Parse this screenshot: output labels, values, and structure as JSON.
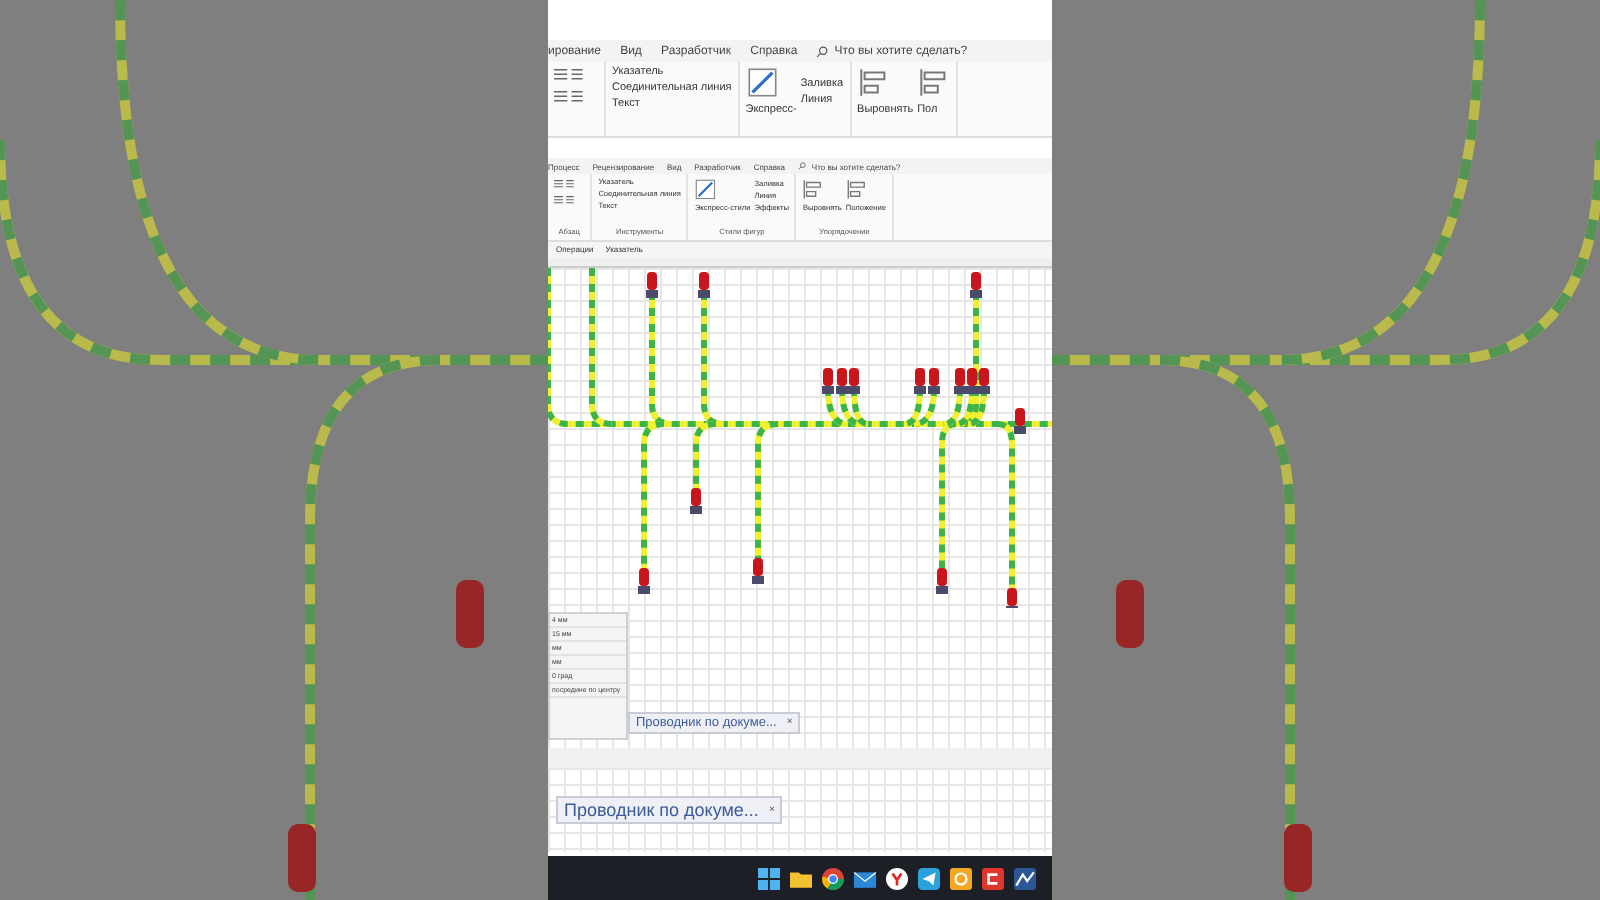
{
  "ribbon_top": {
    "tabs": [
      "ирование",
      "Вид",
      "Разработчик",
      "Справка"
    ],
    "search": "Что вы хотите сделать?",
    "tools": [
      "Указатель",
      "Соединительная линия",
      "Текст"
    ],
    "styles": "Экспресс-",
    "format": [
      "Заливка",
      "Линия"
    ],
    "arrange": [
      "Выровнять",
      "Пол"
    ]
  },
  "ribbon": {
    "tabs": [
      "Процесс",
      "Рецензирование",
      "Вид",
      "Разработчик",
      "Справка"
    ],
    "search": "Что вы хотите сделать?",
    "tools": [
      "Указатель",
      "Соединительная линия",
      "Текст"
    ],
    "styles": "Экспресс-стили",
    "format": [
      "Заливка",
      "Линия",
      "Эффекты"
    ],
    "arrange": [
      "Выровнять",
      "Положение"
    ],
    "groups": [
      "Абзац",
      "Инструменты",
      "Стили фигур",
      "Упорядочение"
    ]
  },
  "toolbar": [
    "Операции",
    "Указатель"
  ],
  "properties": [
    "4 мм",
    "15 мм",
    "мм",
    "мм",
    "0 град",
    "посредине по центру"
  ],
  "doc_tabs": [
    {
      "label": "Проводник по докуме...",
      "close": "×"
    },
    {
      "label": "Проводник по докуме...",
      "close": "×"
    }
  ]
}
